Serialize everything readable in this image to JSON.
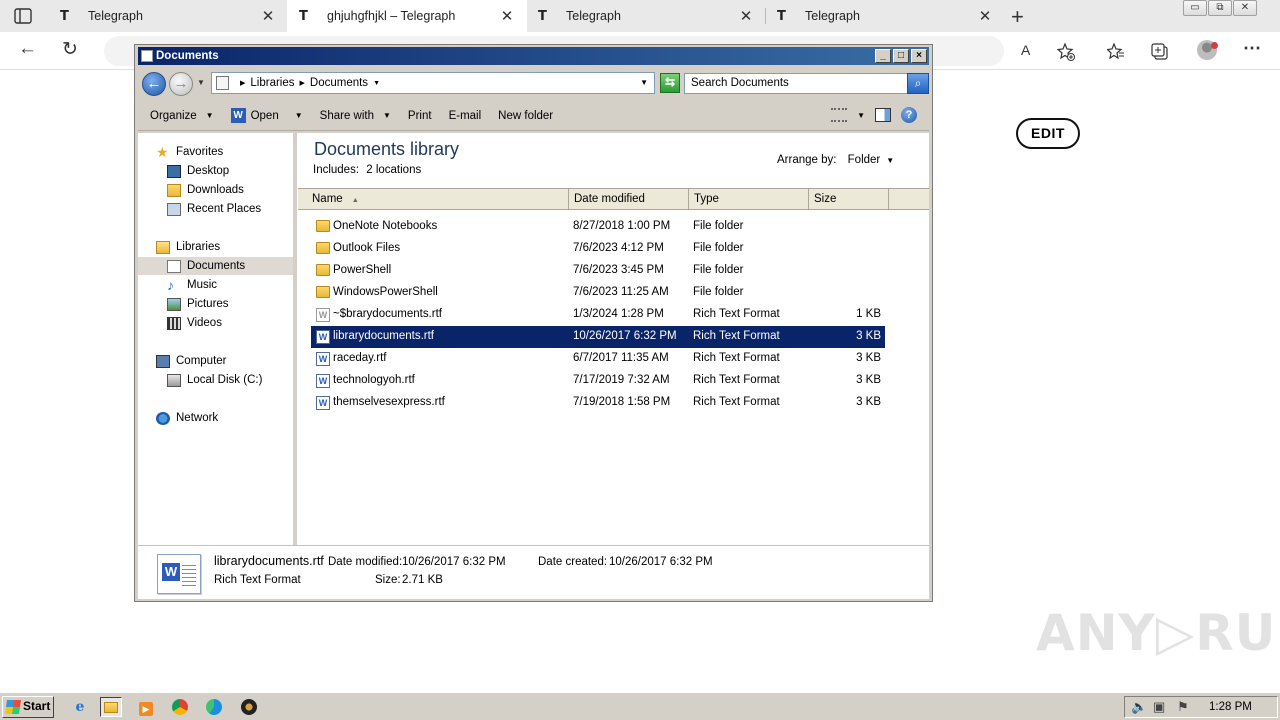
{
  "browser": {
    "tabs": [
      {
        "favicon": "T",
        "title": "Telegraph",
        "close": "✕"
      },
      {
        "favicon": "T",
        "title": "ghjuhgfhjkl – Telegraph",
        "close": "✕"
      },
      {
        "favicon": "T",
        "title": "Telegraph",
        "close": "✕"
      },
      {
        "favicon": "T",
        "title": "Telegraph",
        "close": "✕"
      }
    ],
    "new_tab": "+",
    "nav": {
      "back": "←",
      "reload": "↻"
    },
    "window_controls": {
      "minimize": "▭",
      "restore": "⧉",
      "close": "✕"
    },
    "toolbar_icons": [
      "read-aloud-icon",
      "add-favorite-icon",
      "favorites-icon",
      "collections-icon",
      "profile-icon",
      "more-icon"
    ],
    "more": "⋯",
    "read_aloud": "A",
    "edit_badge": "EDIT",
    "watermark": "ANY▷RUN"
  },
  "explorer": {
    "title": "Documents",
    "title_buttons": {
      "minimize": "_",
      "maximize": "□",
      "close": "×"
    },
    "breadcrumb": [
      "Libraries",
      "Documents"
    ],
    "search_placeholder": "Search Documents",
    "toolbar": {
      "organize": "Organize",
      "open": "Open",
      "share_with": "Share with",
      "print": "Print",
      "email": "E-mail",
      "new_folder": "New folder"
    },
    "nav_pane": {
      "favorites": "Favorites",
      "favorites_items": [
        "Desktop",
        "Downloads",
        "Recent Places"
      ],
      "libraries": "Libraries",
      "libraries_items": [
        "Documents",
        "Music",
        "Pictures",
        "Videos"
      ],
      "computer": "Computer",
      "computer_items": [
        "Local Disk (C:)"
      ],
      "network": "Network"
    },
    "library": {
      "title": "Documents library",
      "includes_label": "Includes:",
      "includes_link": "2 locations",
      "arrange_label": "Arrange by:",
      "arrange_value": "Folder"
    },
    "columns": [
      "Name",
      "Date modified",
      "Type",
      "Size"
    ],
    "files": [
      {
        "name": "OneNote Notebooks",
        "date": "8/27/2018 1:00 PM",
        "type": "File folder",
        "size": "",
        "kind": "folder"
      },
      {
        "name": "Outlook Files",
        "date": "7/6/2023 4:12 PM",
        "type": "File folder",
        "size": "",
        "kind": "folder"
      },
      {
        "name": "PowerShell",
        "date": "7/6/2023 3:45 PM",
        "type": "File folder",
        "size": "",
        "kind": "folder"
      },
      {
        "name": "WindowsPowerShell",
        "date": "7/6/2023 11:25 AM",
        "type": "File folder",
        "size": "",
        "kind": "folder"
      },
      {
        "name": "~$brarydocuments.rtf",
        "date": "1/3/2024 1:28 PM",
        "type": "Rich Text Format",
        "size": "1 KB",
        "kind": "tmp"
      },
      {
        "name": "librarydocuments.rtf",
        "date": "10/26/2017 6:32 PM",
        "type": "Rich Text Format",
        "size": "3 KB",
        "kind": "doc",
        "selected": true
      },
      {
        "name": "raceday.rtf",
        "date": "6/7/2017 11:35 AM",
        "type": "Rich Text Format",
        "size": "3 KB",
        "kind": "doc"
      },
      {
        "name": "technologyoh.rtf",
        "date": "7/17/2019 7:32 AM",
        "type": "Rich Text Format",
        "size": "3 KB",
        "kind": "doc"
      },
      {
        "name": "themselvesexpress.rtf",
        "date": "7/19/2018 1:58 PM",
        "type": "Rich Text Format",
        "size": "3 KB",
        "kind": "doc"
      }
    ],
    "details": {
      "name": "librarydocuments.rtf",
      "modified_label": "Date modified:",
      "modified": "10/26/2017 6:32 PM",
      "created_label": "Date created:",
      "created": "10/26/2017 6:32 PM",
      "type": "Rich Text Format",
      "size_label": "Size:",
      "size": "2.71 KB"
    }
  },
  "taskbar": {
    "start": "Start",
    "clock": "1:28 PM"
  }
}
